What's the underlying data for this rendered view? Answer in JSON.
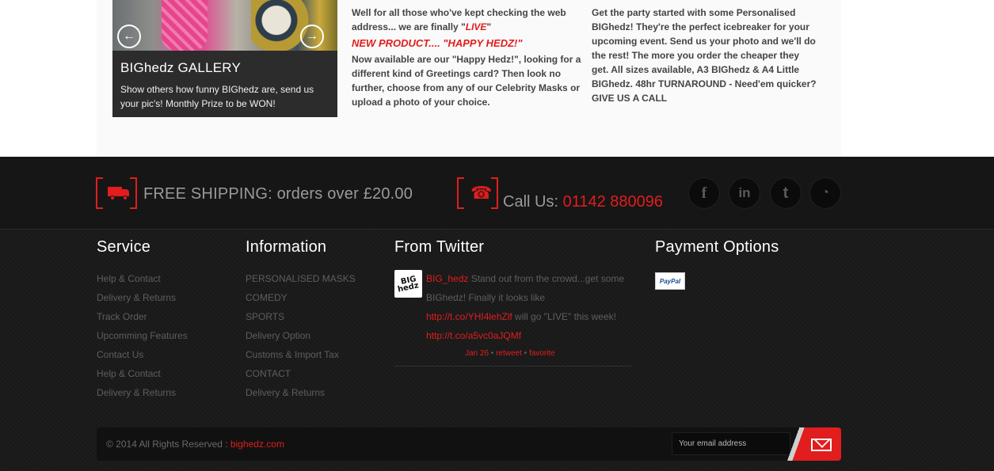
{
  "gallery": {
    "title": "BIGhedz GALLERY",
    "text": "Show others how funny BIGhedz are, send us your pic's! Monthly Prize to be WON!",
    "prev_arrow": "←",
    "next_arrow": "→"
  },
  "news": {
    "line1_a": "Well for all those who've kept checking the web address... we are finally \"",
    "live": "LIVE",
    "line1_b": "\"",
    "product": "NEW PRODUCT.... \"HAPPY HEDZ!\"",
    "body": "Now available are our \"Happy Hedz!\", looking for a different kind of Greetings card? Then look no further, choose from any of our Celebrity Masks or upload a photo of your choice."
  },
  "party": {
    "body": "Get the party started with some Personalised BIGhedz! They're the perfect icebreaker for your upcoming event. Send us your photo and we'll do the rest! The more you order the cheaper they get.  All sizes available, A3 BIGhedz & A4 Little BIGhedz. 48hr TURNAROUND - Need'em quicker? GIVE US A CALL"
  },
  "banner": {
    "shipping": "FREE SHIPPING: orders over £20.00",
    "call_label": "Call Us: ",
    "call_number": "01142 880096",
    "phone_glyph": "☎"
  },
  "social": {
    "facebook": "f",
    "linkedin": "in",
    "twitter": "t",
    "rss": "◔"
  },
  "service": {
    "heading": "Service",
    "items": [
      "Help & Contact",
      "Delivery & Returns",
      "Track Order",
      "Upcomming Features",
      "Contact Us",
      "Help & Contact",
      "Delivery & Returns"
    ]
  },
  "information": {
    "heading": "Information",
    "items": [
      "PERSONALISED MASKS",
      "COMEDY",
      "SPORTS",
      "Delivery Option",
      "Customs & Import Tax",
      "CONTACT",
      "Delivery & Returns"
    ]
  },
  "twitter": {
    "heading": "From Twitter",
    "avatar_top": "BIG",
    "avatar_bottom": "hedz",
    "user": "BIG_hedz",
    "text_a": " Stand out from the crowd...get some BIGhedz! Finally it looks like ",
    "link1": "http://t.co/YHI4lehZlf",
    "text_b": " will go \"LIVE\" this week! ",
    "link2": "http://t.co/a5vc0aJQMf",
    "date": "Jan 26",
    "sep": " • ",
    "retweet": "retweet",
    "favorite": "favorite"
  },
  "payment": {
    "heading": "Payment Options",
    "paypal": "PayPal"
  },
  "bottom": {
    "copyright": "© 2014 All Rights Reserved : ",
    "site": "bighedz.com",
    "email_placeholder": "Your email address"
  }
}
